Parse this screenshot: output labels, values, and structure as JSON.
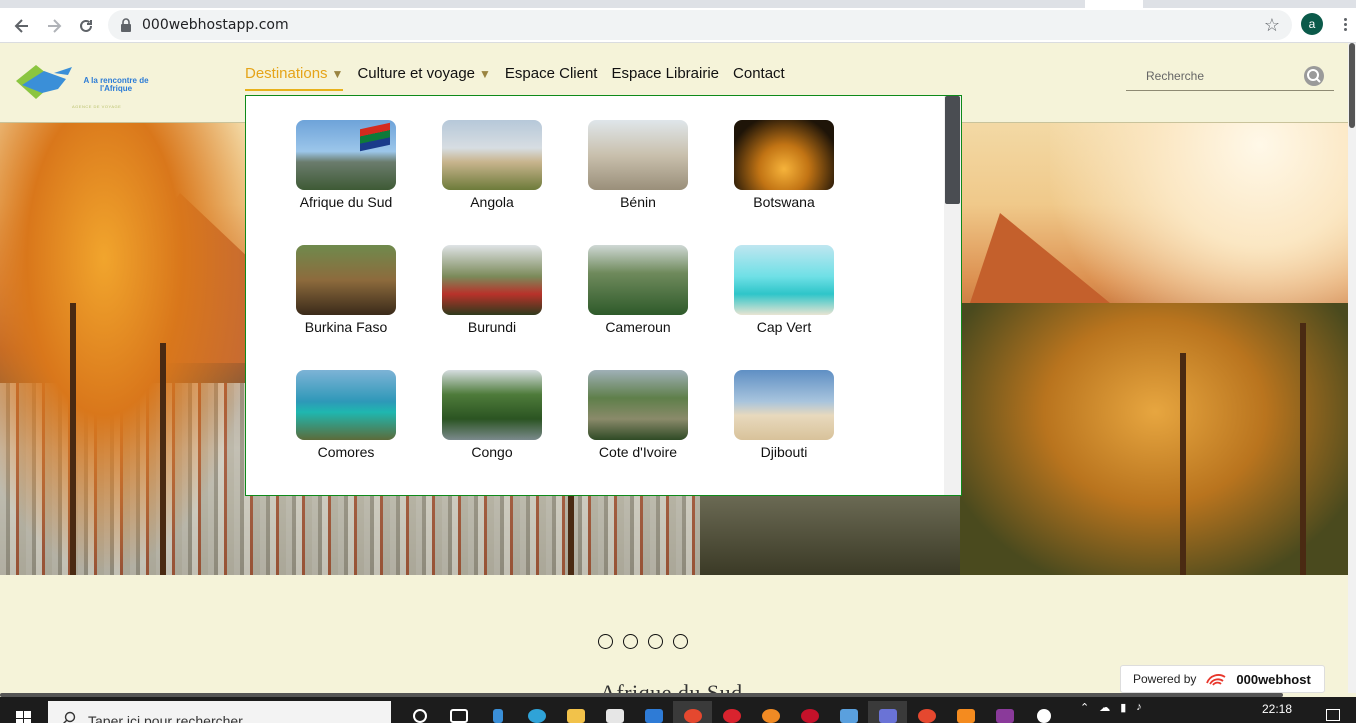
{
  "browser": {
    "url": "000webhostapp.com",
    "profile_initial": "a"
  },
  "site": {
    "logo_text": "A la rencontre de l'Afrique",
    "logo_tagline": "AGENCE DE VOYAGE",
    "nav": [
      {
        "label": "Destinations",
        "active": true,
        "has_menu": true
      },
      {
        "label": "Culture et voyage",
        "active": false,
        "has_menu": true
      },
      {
        "label": "Espace Client",
        "active": false,
        "has_menu": false
      },
      {
        "label": "Espace Librairie",
        "active": false,
        "has_menu": false
      },
      {
        "label": "Contact",
        "active": false,
        "has_menu": false
      }
    ],
    "caret": "▼",
    "search_placeholder": "Recherche"
  },
  "destinations": [
    {
      "label": "Afrique du Sud"
    },
    {
      "label": "Angola"
    },
    {
      "label": "Bénin"
    },
    {
      "label": "Botswana"
    },
    {
      "label": "Burkina Faso"
    },
    {
      "label": "Burundi"
    },
    {
      "label": "Cameroun"
    },
    {
      "label": "Cap Vert"
    },
    {
      "label": "Comores"
    },
    {
      "label": "Congo"
    },
    {
      "label": "Cote d'Ivoire"
    },
    {
      "label": "Djibouti"
    }
  ],
  "carousel": {
    "dots": 4
  },
  "section_title": "Afrique du Sud",
  "powered_by": {
    "prefix": "Powered by",
    "brand": "000webhost"
  },
  "taskbar": {
    "search_placeholder": "Taper ici pour rechercher",
    "time": "22:18"
  },
  "colors": {
    "accent": "#e5a41a",
    "dropdown_border": "#0e8a1a",
    "page_bg": "#f5f3d9"
  }
}
